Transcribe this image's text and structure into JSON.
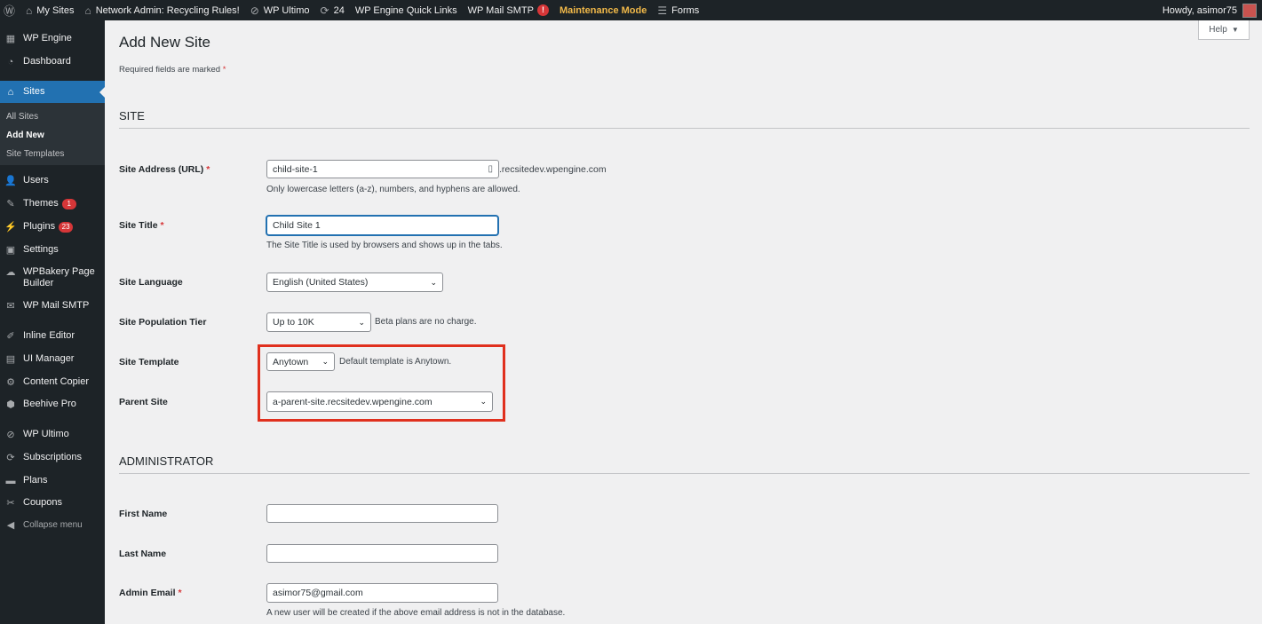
{
  "adminbar": {
    "items": [
      {
        "icon": "wordpress-icon",
        "label": ""
      },
      {
        "icon": "my-sites-icon",
        "label": "My Sites"
      },
      {
        "icon": "home-icon",
        "label": "Network Admin: Recycling Rules!"
      },
      {
        "icon": "wp-ultimo-icon",
        "label": "WP Ultimo"
      },
      {
        "icon": "updates-icon",
        "label": "24"
      },
      {
        "icon": "",
        "label": "WP Engine Quick Links"
      },
      {
        "icon": "",
        "label": "WP Mail SMTP"
      },
      {
        "icon": "",
        "label": "Maintenance Mode"
      },
      {
        "icon": "forms-icon",
        "label": "Forms"
      }
    ],
    "smtp_badge": "!",
    "howdy": "Howdy, asimor75"
  },
  "sidebar": {
    "wp_engine": "WP Engine",
    "dashboard": "Dashboard",
    "sites": "Sites",
    "sub": [
      "All Sites",
      "Add New",
      "Site Templates"
    ],
    "users": "Users",
    "themes": "Themes",
    "themes_badge": "1",
    "plugins": "Plugins",
    "plugins_badge": "23",
    "settings": "Settings",
    "wpbakery": "WPBakery Page Builder",
    "wpmail": "WP Mail SMTP",
    "inline_editor": "Inline Editor",
    "ui_manager": "UI Manager",
    "content_copier": "Content Copier",
    "beehive": "Beehive Pro",
    "wp_ultimo": "WP Ultimo",
    "subscriptions": "Subscriptions",
    "plans": "Plans",
    "coupons": "Coupons",
    "collapse": "Collapse menu"
  },
  "main": {
    "help": "Help",
    "title": "Add New Site",
    "required_note": "Required fields are marked",
    "required_star": "*",
    "section_site": "SITE",
    "section_admin": "ADMINISTRATOR",
    "site_address_label": "Site Address (URL)",
    "site_address_value": "child-site-1",
    "site_address_suffix": ".recsitedev.wpengine.com",
    "site_address_desc": "Only lowercase letters (a-z), numbers, and hyphens are allowed.",
    "site_title_label": "Site Title",
    "site_title_value": "Child Site 1",
    "site_title_desc": "The Site Title is used by browsers and shows up in the tabs.",
    "site_language_label": "Site Language",
    "site_language_value": "English (United States)",
    "population_label": "Site Population Tier",
    "population_value": "Up to 10K",
    "population_note": "Beta plans are no charge.",
    "template_label": "Site Template",
    "template_value": "Anytown",
    "template_note": "Default template is Anytown.",
    "parent_label": "Parent Site",
    "parent_value": "a-parent-site.recsitedev.wpengine.com",
    "first_name_label": "First Name",
    "last_name_label": "Last Name",
    "admin_email_label": "Admin Email",
    "admin_email_value": "asimor75@gmail.com",
    "admin_email_desc": "A new user will be created if the above email address is not in the database."
  }
}
